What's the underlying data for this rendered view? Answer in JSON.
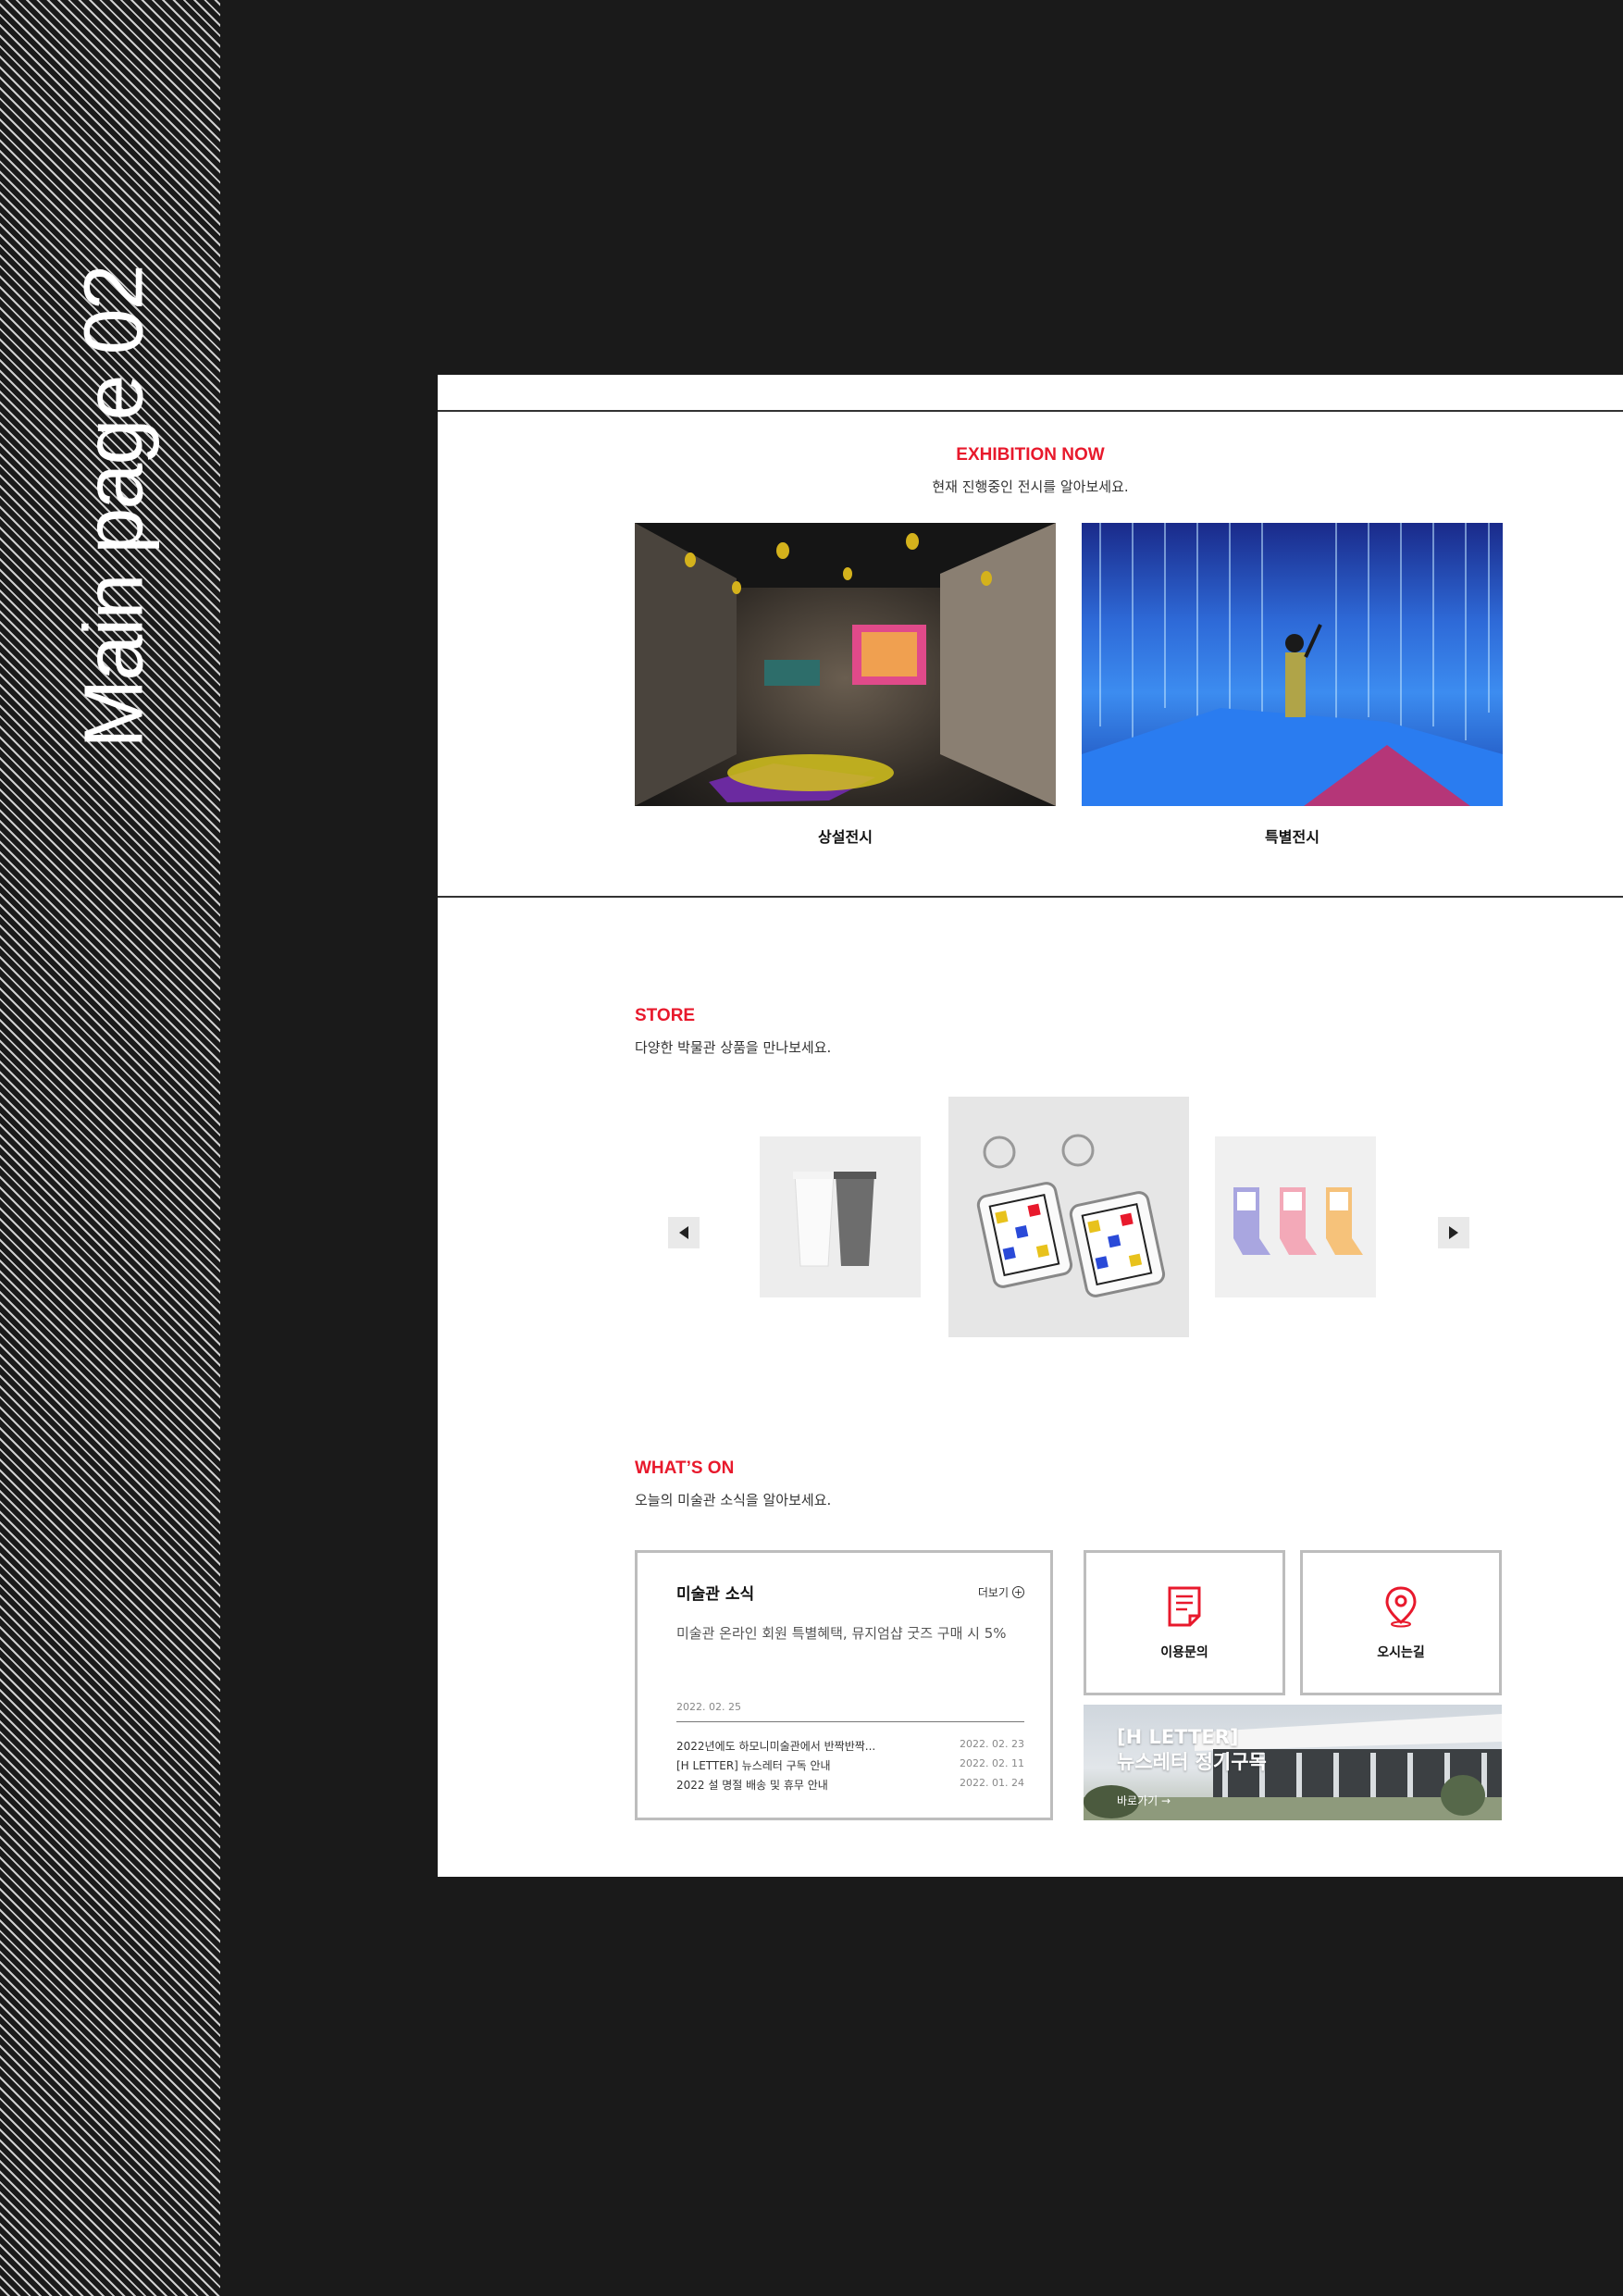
{
  "side_title": "Main page 02",
  "exhibition": {
    "title": "EXHIBITION NOW",
    "subtitle": "현재 진행중인 전시를 알아보세요.",
    "cards": [
      {
        "label": "상설전시"
      },
      {
        "label": "특별전시"
      }
    ]
  },
  "store": {
    "title": "STORE",
    "subtitle": "다양한 박물관 상품을 만나보세요."
  },
  "whats_on": {
    "title": "WHAT’S ON",
    "subtitle": "오늘의 미술관 소식을 알아보세요.",
    "news": {
      "title": "미술관 소식",
      "more": "더보기",
      "lead": "미술관 온라인 회원 특별혜택, 뮤지엄샵 굿즈 구매 시 5%",
      "lead_date": "2022. 02. 25",
      "items": [
        {
          "text": "2022년에도 하모니미술관에서 반짝반짝...",
          "date": "2022. 02. 23"
        },
        {
          "text": "[H LETTER] 뉴스레터 구독 안내",
          "date": "2022. 02. 11"
        },
        {
          "text": "2022 설 명절 배송 및 휴무 안내",
          "date": "2022. 01. 24"
        }
      ]
    },
    "tiles": [
      {
        "label": "이용문의",
        "icon": "document-icon"
      },
      {
        "label": "오시는길",
        "icon": "map-pin-icon"
      }
    ],
    "banner": {
      "line1": "[H LETTER]",
      "line2": "뉴스레터 정기구독",
      "link": "바로가기 →"
    }
  },
  "colors": {
    "accent": "#e8192c",
    "background": "#1a1a1a"
  }
}
